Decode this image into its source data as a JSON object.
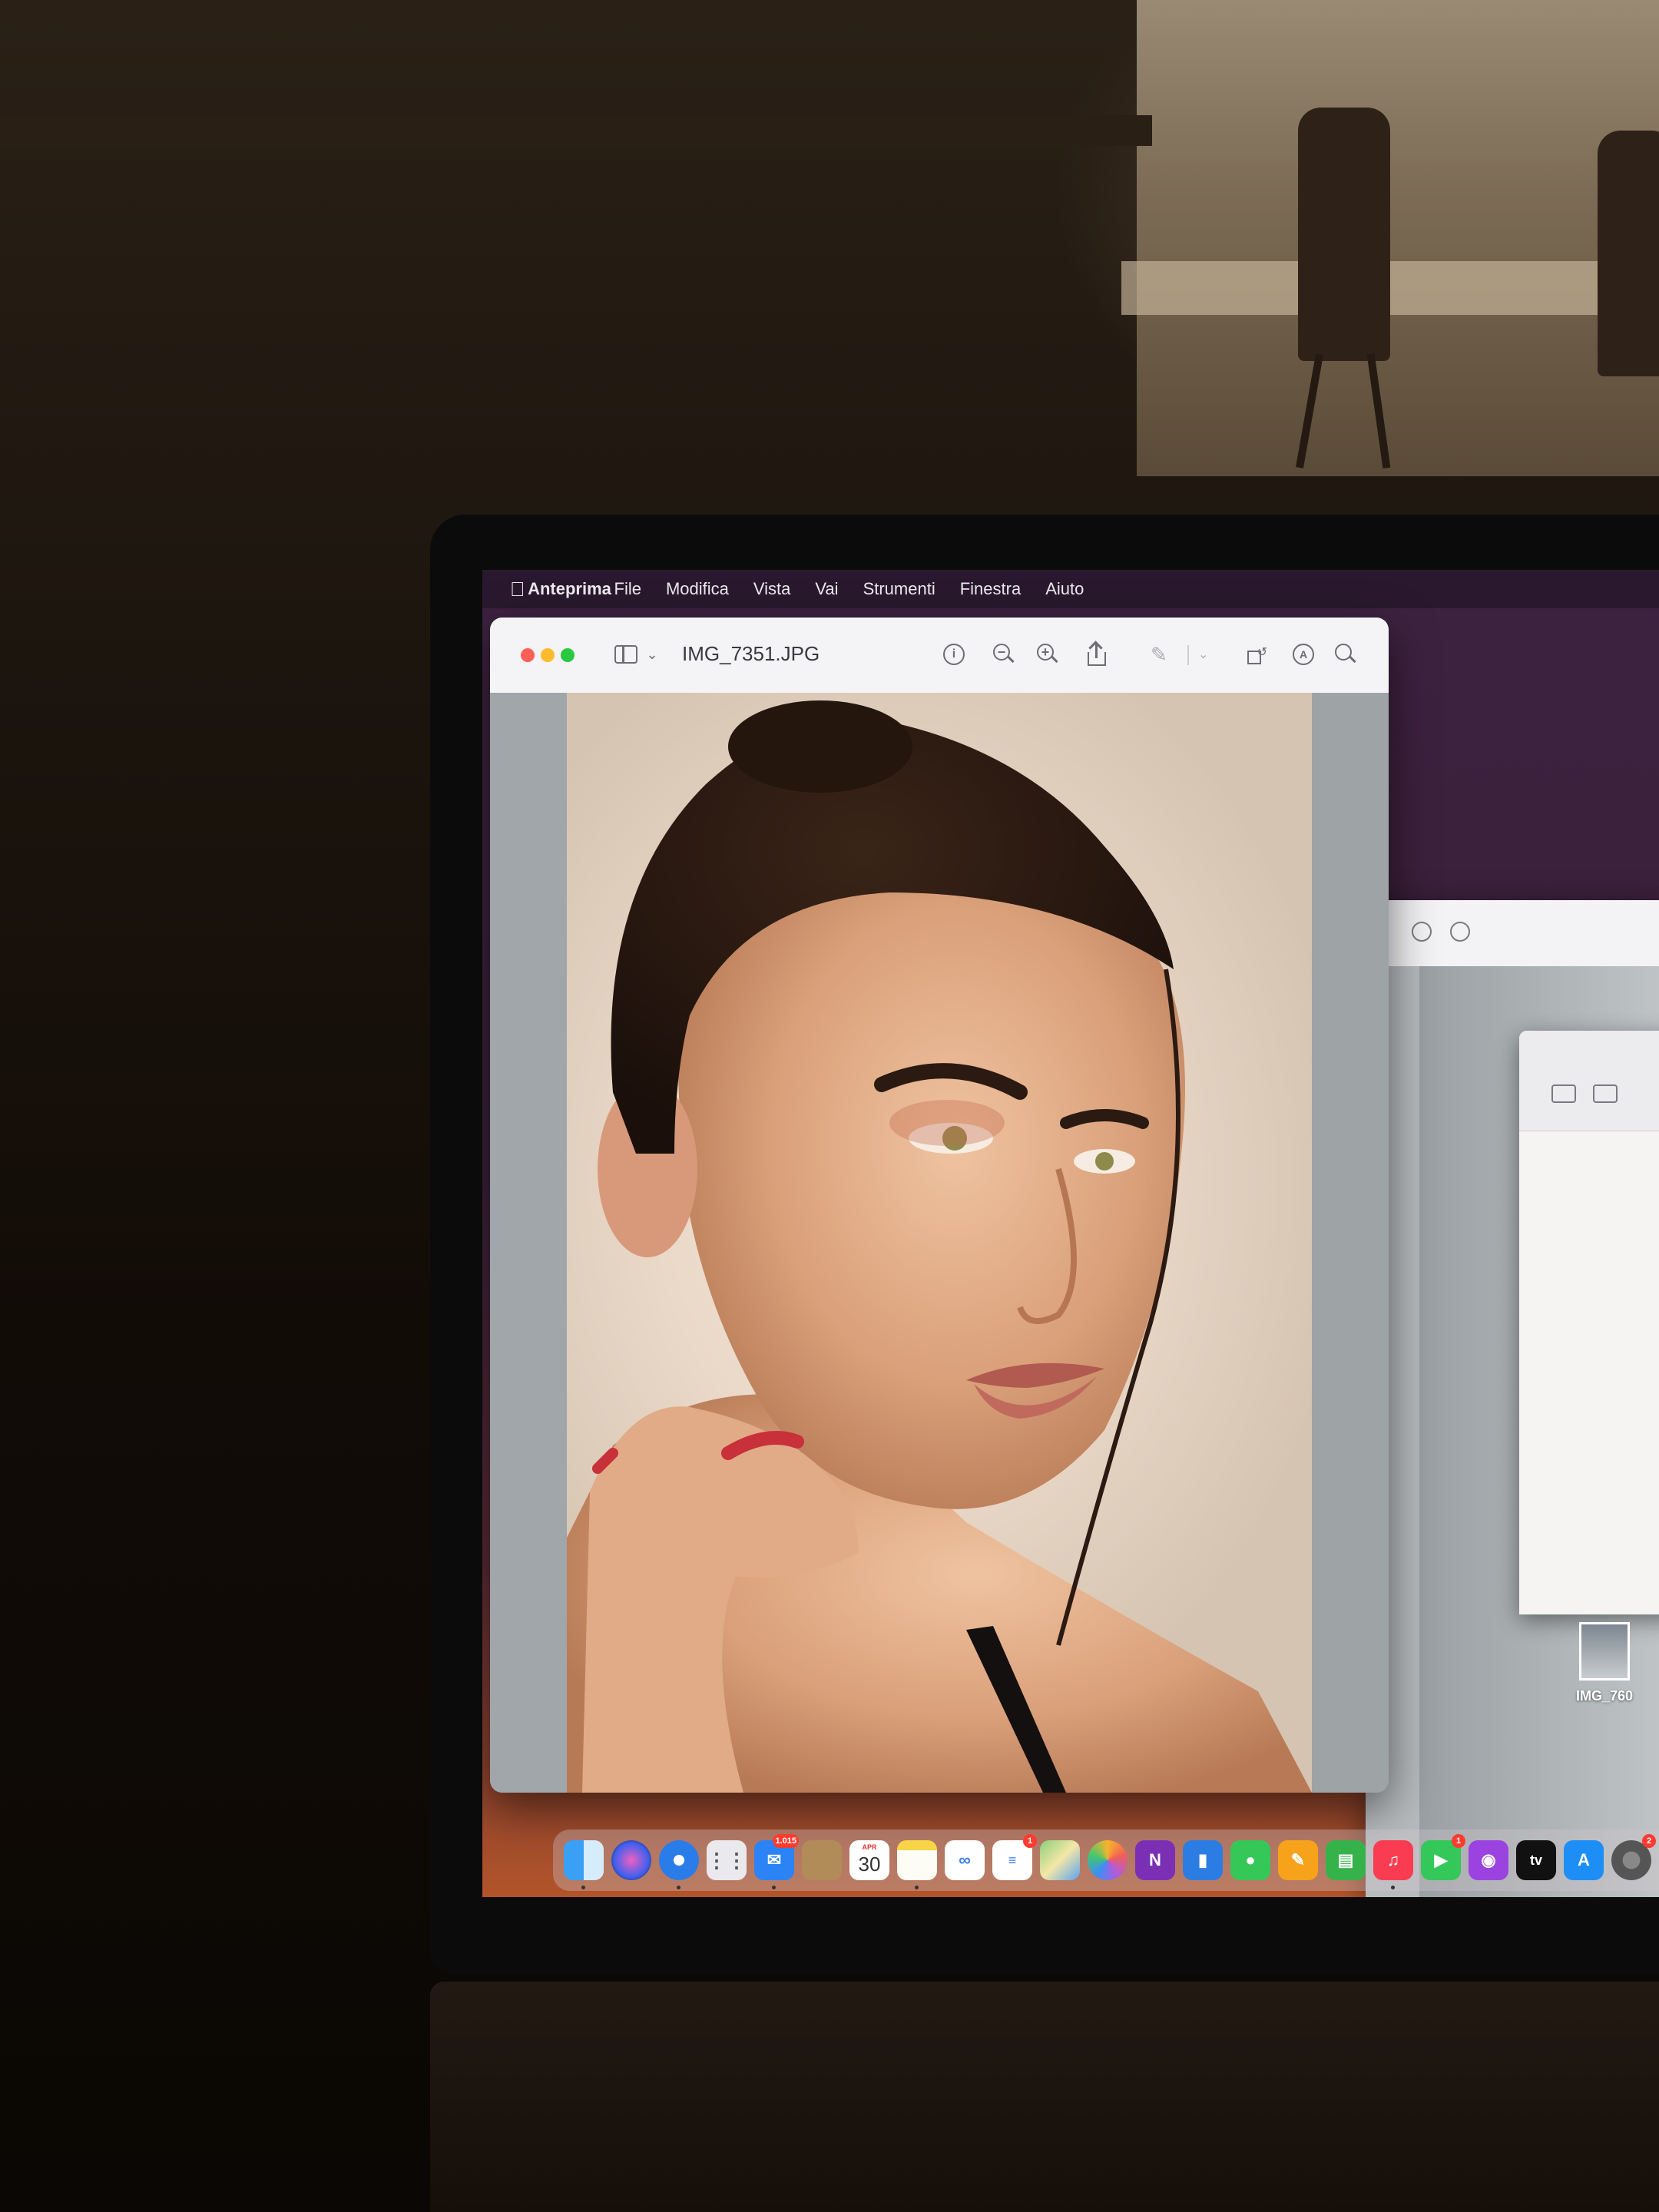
{
  "menubar": {
    "items": [
      "Anteprima",
      "File",
      "Modifica",
      "Vista",
      "Vai",
      "Strumenti",
      "Finestra",
      "Aiuto"
    ]
  },
  "preview_window": {
    "title": "IMG_7351.JPG",
    "info_symbol": "i"
  },
  "desktop": {
    "file_label": "IMG_760"
  },
  "dock": {
    "mail_badge": "1.015",
    "calendar_month": "APR",
    "calendar_day": "30",
    "reminders_badge": "1",
    "facetime_badge": "1",
    "settings_badge": "2",
    "tv_label": "tv"
  },
  "colors": {
    "close": "#fe5f57",
    "minimize": "#febc2e",
    "zoom": "#28c840",
    "badge": "#ff3b30"
  }
}
